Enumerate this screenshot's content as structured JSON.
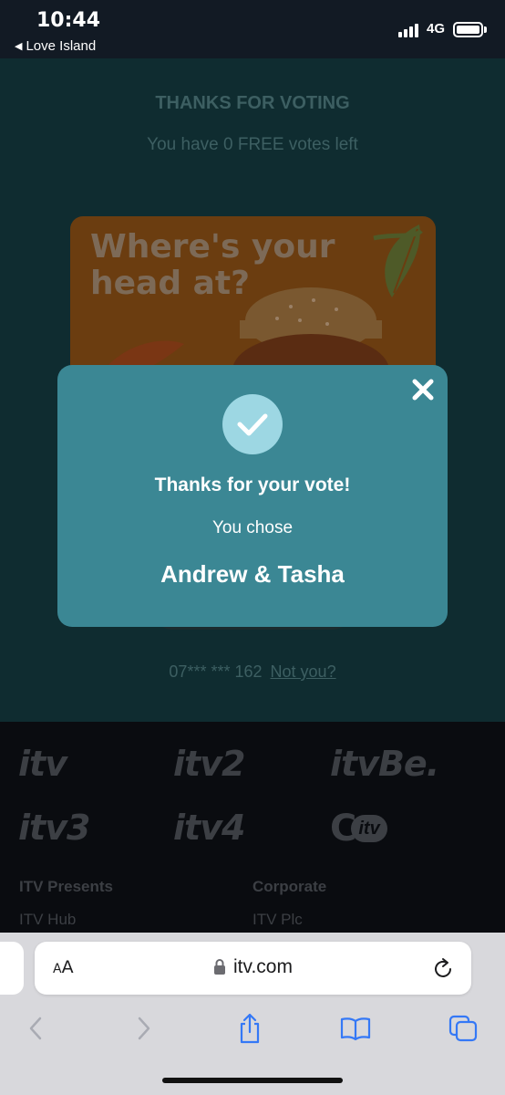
{
  "status_bar": {
    "time": "10:44",
    "back_app": "Love Island",
    "network": "4G"
  },
  "page": {
    "heading": "THANKS FOR VOTING",
    "subheading": "You have 0 FREE votes left",
    "ad": {
      "headline_line1": "Where's your",
      "headline_line2": "head at?"
    },
    "phone_number": "07*** *** 162",
    "not_you_link": "Not you?"
  },
  "modal": {
    "title": "Thanks for your vote!",
    "chose_label": "You chose",
    "couple": "Andrew & Tasha",
    "close_icon": "close-icon",
    "check_icon": "checkmark-icon"
  },
  "footer": {
    "logos": [
      "itv",
      "itv2",
      "itvBe.",
      "itv3",
      "itv4",
      "CITV"
    ],
    "columns": [
      {
        "heading": "ITV Presents",
        "first_link": "ITV Hub"
      },
      {
        "heading": "Corporate",
        "first_link": "ITV Plc"
      }
    ]
  },
  "browser": {
    "text_size_button": "AA",
    "url": "itv.com",
    "icons": [
      "lock-icon",
      "reload-icon",
      "back-icon",
      "forward-icon",
      "share-icon",
      "bookmarks-icon",
      "tabs-icon"
    ]
  },
  "colors": {
    "modal_bg": "#3b8794",
    "check_circle": "#9dd7e3",
    "page_overlay": "#0f2c30",
    "safari_accent": "#3478f6"
  }
}
